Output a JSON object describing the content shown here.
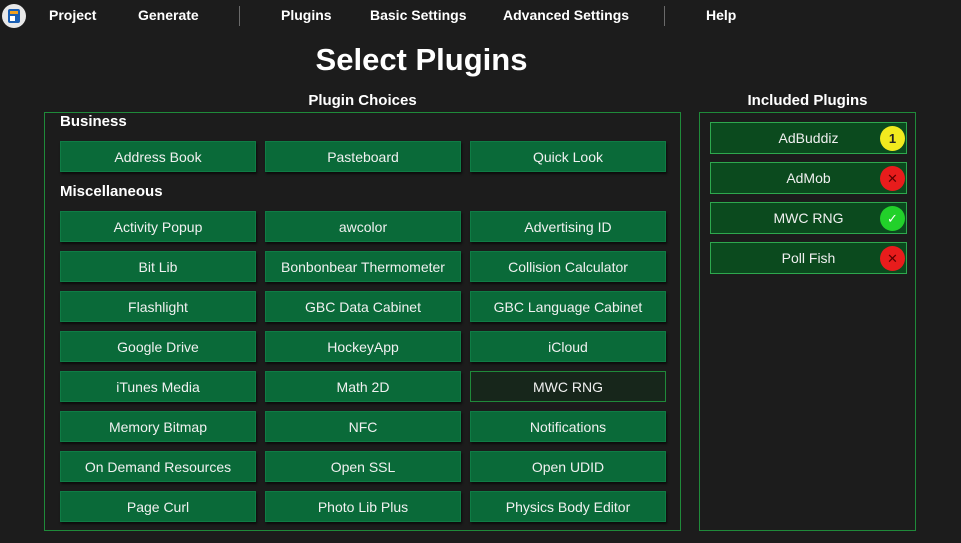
{
  "menu": {
    "project": "Project",
    "generate": "Generate",
    "plugins": "Plugins",
    "basic_settings": "Basic Settings",
    "advanced_settings": "Advanced Settings",
    "help": "Help"
  },
  "page_title": "Select Plugins",
  "choices_heading": "Plugin Choices",
  "included_heading": "Included Plugins",
  "categories": [
    {
      "label": "Business",
      "plugins": [
        "Address Book",
        "Pasteboard",
        "Quick Look"
      ]
    },
    {
      "label": "Miscellaneous",
      "plugins": [
        "Activity Popup",
        "awcolor",
        "Advertising ID",
        "Bit Lib",
        "Bonbonbear Thermometer",
        "Collision Calculator",
        "Flashlight",
        "GBC Data Cabinet",
        "GBC Language Cabinet",
        "Google Drive",
        "HockeyApp",
        "iCloud",
        "iTunes Media",
        "Math 2D",
        "MWC RNG",
        "Memory Bitmap",
        "NFC",
        "Notifications",
        "On Demand Resources",
        "Open SSL",
        "Open UDID",
        "Page Curl",
        "Photo Lib Plus",
        "Physics Body Editor"
      ]
    }
  ],
  "selected_plugin": "MWC RNG",
  "included": [
    {
      "name": "AdBuddiz",
      "status": "warning",
      "badge": "1",
      "icon": "number-badge-icon",
      "color": "#f2ea1e"
    },
    {
      "name": "AdMob",
      "status": "error",
      "badge": "✕",
      "icon": "error-x-icon",
      "color": "#e81c1c"
    },
    {
      "name": "MWC RNG",
      "status": "ok",
      "badge": "✓",
      "icon": "checkmark-icon",
      "color": "#22d12a"
    },
    {
      "name": "Poll Fish",
      "status": "error",
      "badge": "✕",
      "icon": "error-x-icon",
      "color": "#e81c1c"
    }
  ],
  "colors": {
    "background": "#1c1c1c",
    "button": "#0a6a39",
    "panel_border": "#1f8a3a",
    "included_bg": "#0b4a1e"
  }
}
